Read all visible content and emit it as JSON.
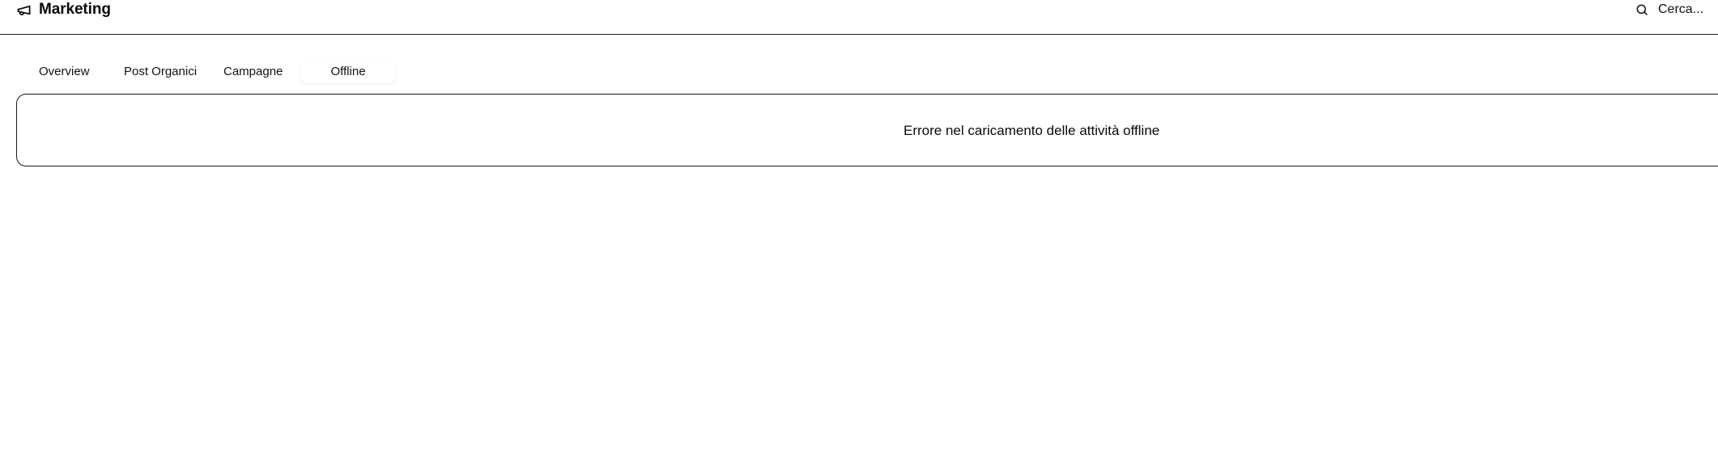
{
  "header": {
    "title": "Marketing",
    "icon": "megaphone-icon",
    "search": {
      "icon": "search-icon",
      "placeholder": "Cerca..."
    }
  },
  "tabs": [
    {
      "label": "Overview",
      "active": false
    },
    {
      "label": "Post Organici",
      "active": false
    },
    {
      "label": "Campagne",
      "active": false
    },
    {
      "label": "Offline",
      "active": true
    }
  ],
  "main": {
    "error_message": "Errore nel caricamento delle attività offline"
  },
  "colors": {
    "text": "#0a0a0a",
    "border": "#1a1a1a",
    "background": "#ffffff"
  }
}
